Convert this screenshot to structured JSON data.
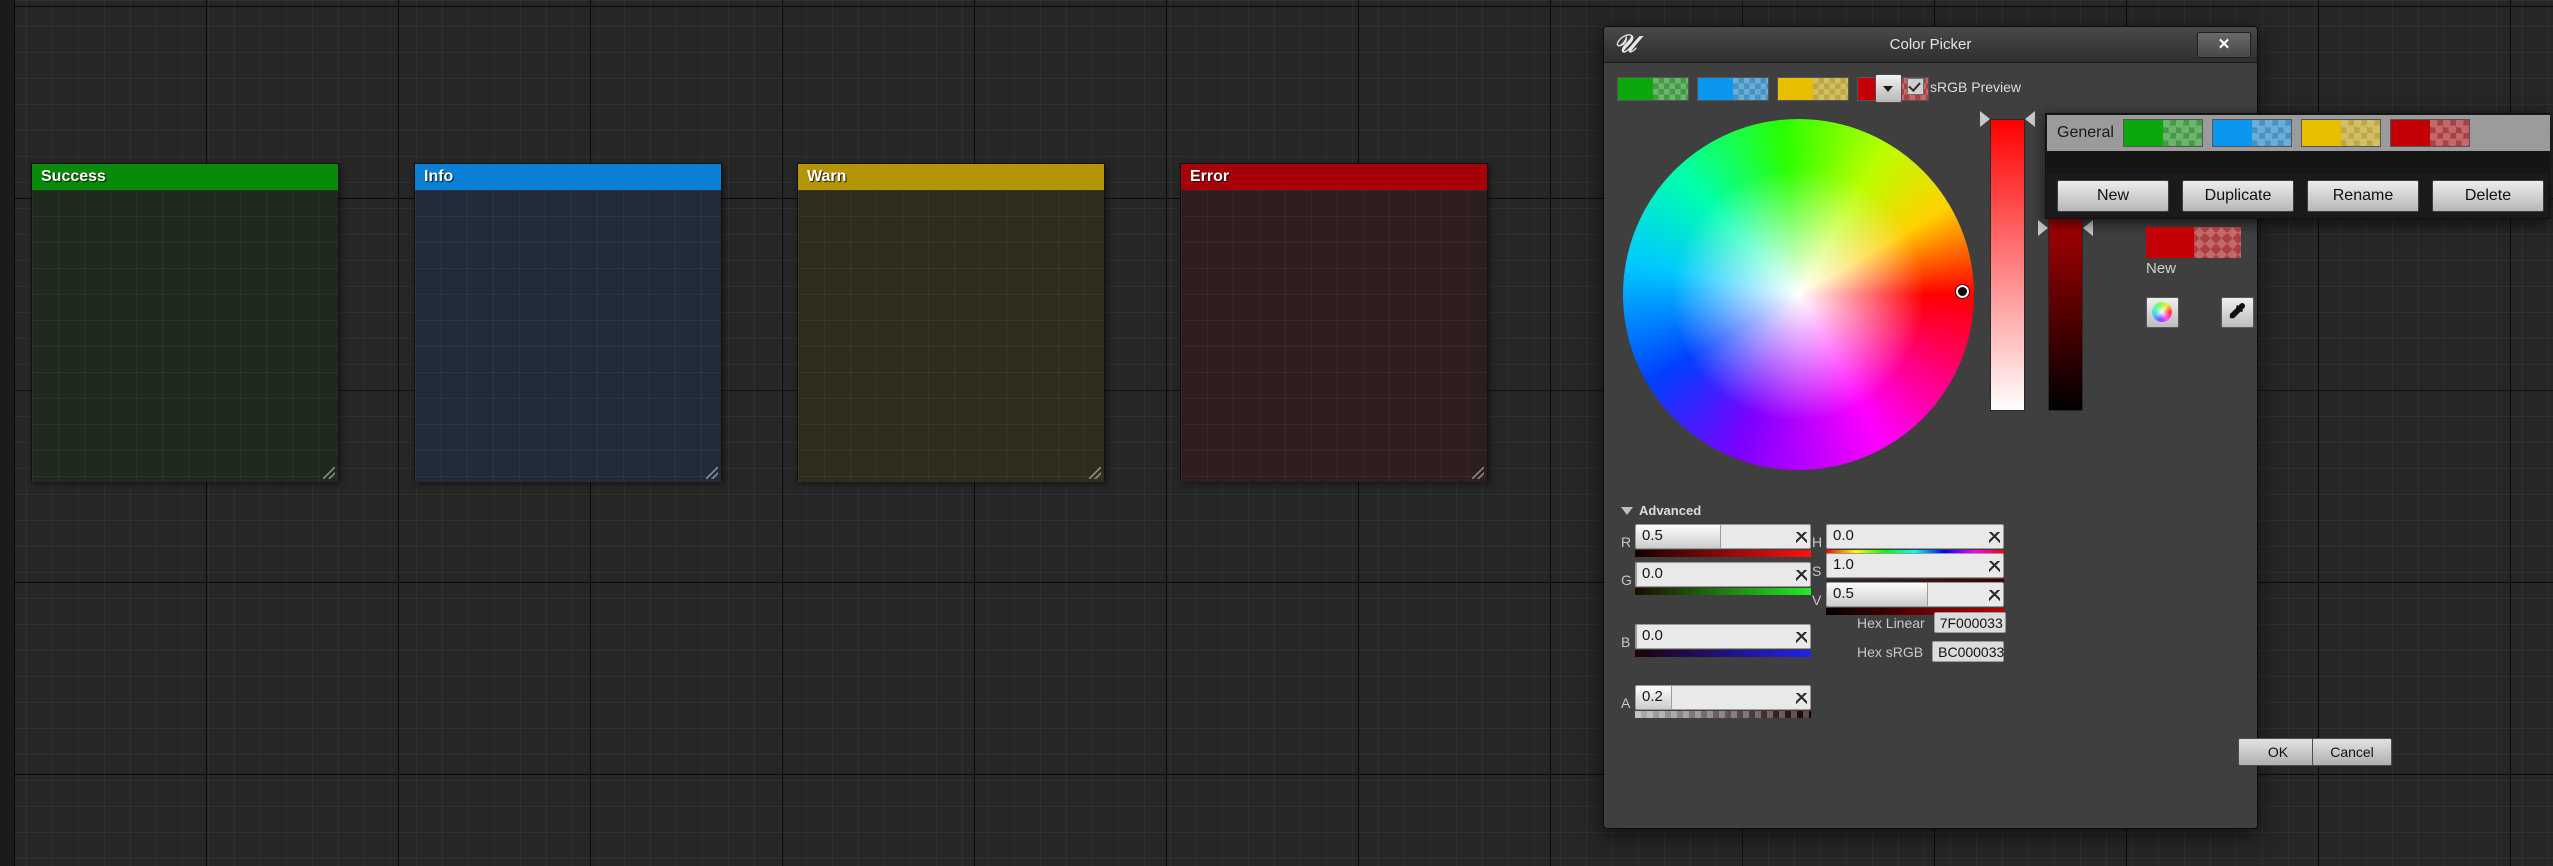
{
  "viewport": {
    "cards": [
      {
        "id": "success",
        "label": "Success",
        "header_color": "#0a8a0a",
        "body_color": "#1e2b1c"
      },
      {
        "id": "info",
        "label": "Info",
        "header_color": "#0b7fd4",
        "body_color": "#222c38"
      },
      {
        "id": "warn",
        "label": "Warn",
        "header_color": "#b49508",
        "body_color": "#302d1e"
      },
      {
        "id": "error",
        "label": "Error",
        "header_color": "#a80008",
        "body_color": "#2e1e1e"
      }
    ]
  },
  "dialog": {
    "title": "Color Picker",
    "close_label": "✕",
    "logo": "unreal-engine-logo",
    "srgb_preview_label": "sRGB Preview",
    "srgb_preview_checked": true,
    "swatches": [
      {
        "name": "green",
        "color": "#0aa80a"
      },
      {
        "name": "blue",
        "color": "#0b96f0"
      },
      {
        "name": "yellow",
        "color": "#e8bf00"
      },
      {
        "name": "red",
        "color": "#c40006"
      }
    ],
    "advanced": {
      "label": "Advanced",
      "expanded": true,
      "rgba": [
        {
          "channel": "R",
          "value": "0.5",
          "fill_pct": 48,
          "grad_from": "#140000",
          "grad_to": "#ff1111"
        },
        {
          "channel": "G",
          "value": "0.0",
          "fill_pct": 0,
          "grad_from": "#1a0a00",
          "grad_to": "#22ee22"
        },
        {
          "channel": "B",
          "value": "0.0",
          "fill_pct": 0,
          "grad_from": "#200008",
          "grad_to": "#2222ee"
        },
        {
          "channel": "A",
          "value": "0.2",
          "fill_pct": 20,
          "grad_from": "#b0b0b0",
          "grad_to": "#1a0000"
        }
      ],
      "hsv": [
        {
          "channel": "H",
          "value": "0.0",
          "fill_pct": 0,
          "grad": "hue"
        },
        {
          "channel": "S",
          "value": "1.0",
          "fill_pct": 0,
          "grad_from": "#2e2e2e",
          "grad_to": "#430000"
        },
        {
          "channel": "V",
          "value": "0.5",
          "fill_pct": 57,
          "grad_from": "#000000",
          "grad_to": "#bb0000"
        }
      ]
    },
    "hex": [
      {
        "label": "Hex Linear",
        "value": "7F000033"
      },
      {
        "label": "Hex sRGB",
        "value": "BC000033"
      }
    ],
    "buttons": {
      "ok": "OK",
      "cancel": "Cancel"
    }
  },
  "popup": {
    "group_label": "General",
    "swatches": [
      {
        "name": "green",
        "color": "#0aa80a"
      },
      {
        "name": "blue",
        "color": "#0b96f0"
      },
      {
        "name": "yellow",
        "color": "#e8bf00"
      },
      {
        "name": "red",
        "color": "#c40006"
      }
    ],
    "actions": [
      "New",
      "Duplicate",
      "Rename",
      "Delete"
    ],
    "preview": {
      "label": "New",
      "color": "#c40006"
    },
    "tools": [
      "color-wheel-tool",
      "eyedropper-tool"
    ]
  }
}
